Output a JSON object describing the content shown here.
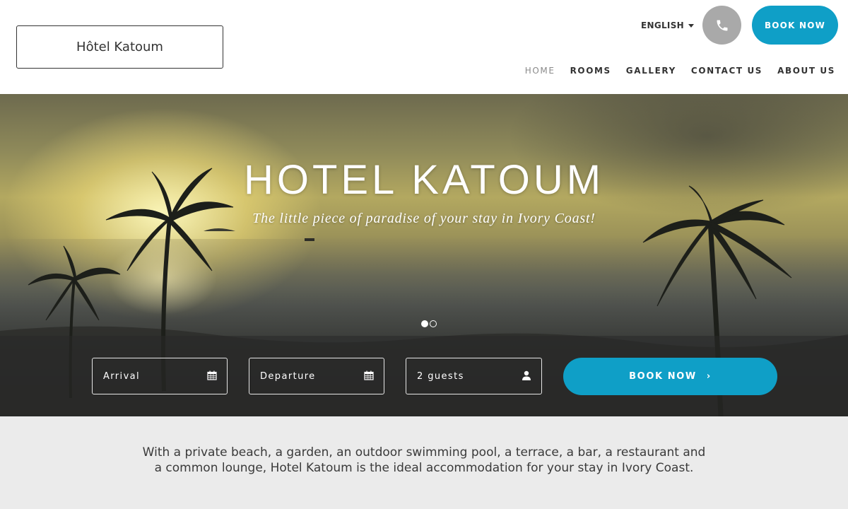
{
  "header": {
    "logo_text": "Hôtel Katoum",
    "language": "ENGLISH",
    "book_label": "BOOK NOW",
    "nav": [
      {
        "label": "HOME"
      },
      {
        "label": "ROOMS"
      },
      {
        "label": "GALLERY"
      },
      {
        "label": "CONTACT US"
      },
      {
        "label": "ABOUT US"
      }
    ]
  },
  "hero": {
    "title": "HOTEL KATOUM",
    "subtitle": "The little piece of paradise of your stay in Ivory Coast!"
  },
  "booking": {
    "arrival": "Arrival",
    "departure": "Departure",
    "guests": "2 guests",
    "button": "BOOK NOW",
    "button_arrow": "›"
  },
  "intro": {
    "text": "With a private beach, a garden, an outdoor swimming pool, a terrace, a bar, a restaurant and a common lounge, Hotel Katoum is the ideal accommodation for your stay in Ivory Coast."
  },
  "colors": {
    "accent": "#0f9fc7",
    "phone_button": "#a9a9a9",
    "intro_bg": "#ebebeb"
  },
  "icons": {
    "phone": "phone-icon",
    "caret": "caret-down-icon",
    "calendar": "calendar-icon",
    "user": "user-icon"
  }
}
